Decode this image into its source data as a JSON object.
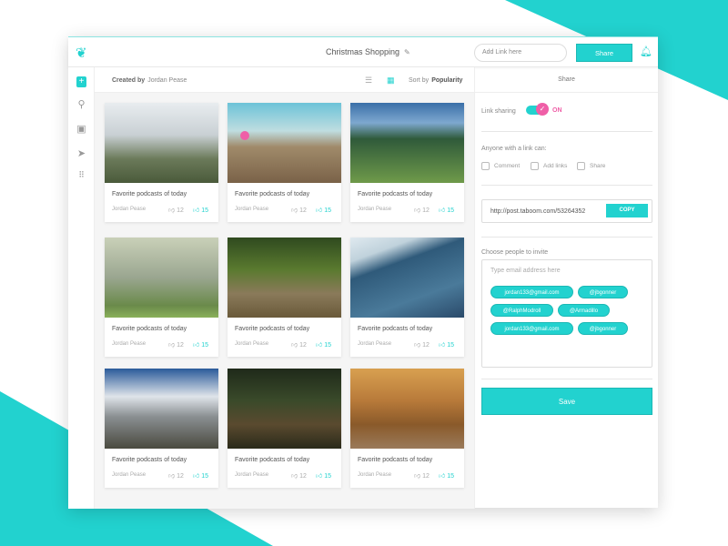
{
  "header": {
    "title": "Christmas Shopping",
    "add_link_placeholder": "Add Link here",
    "share_label": "Share"
  },
  "toolbar": {
    "created_by_label": "Created by",
    "creator": "Jordan Pease",
    "sort_label": "Sort by",
    "sort_value": "Popularity"
  },
  "cards": [
    {
      "title": "Favorite podcasts of today",
      "author": "Jordan Pease",
      "dislikes": "12",
      "likes": "15"
    },
    {
      "title": "Favorite podcasts of today",
      "author": "Jordan Pease",
      "dislikes": "12",
      "likes": "15"
    },
    {
      "title": "Favorite podcasts of today",
      "author": "Jordan Pease",
      "dislikes": "12",
      "likes": "15"
    },
    {
      "title": "Favorite podcasts of today",
      "author": "Jordan Pease",
      "dislikes": "12",
      "likes": "15"
    },
    {
      "title": "Favorite podcasts of today",
      "author": "Jordan Pease",
      "dislikes": "12",
      "likes": "15"
    },
    {
      "title": "Favorite podcasts of today",
      "author": "Jordan Pease",
      "dislikes": "12",
      "likes": "15"
    },
    {
      "title": "Favorite podcasts of today",
      "author": "Jordan Pease",
      "dislikes": "12",
      "likes": "15"
    },
    {
      "title": "Favorite podcasts of today",
      "author": "Jordan Pease",
      "dislikes": "12",
      "likes": "15"
    },
    {
      "title": "Favorite podcasts of today",
      "author": "Jordan Pease",
      "dislikes": "12",
      "likes": "15"
    }
  ],
  "panel": {
    "title": "Share",
    "link_sharing": "Link sharing",
    "toggle_state": "ON",
    "anyone_label": "Anyone with a link can:",
    "options": [
      "Comment",
      "Add links",
      "Share"
    ],
    "url": "http://post.taboom.com/53264352",
    "copy_label": "COPY",
    "invite_label": "Choose people to invite",
    "invite_placeholder": "Type email address here",
    "chips": [
      "jordan133@gmail.com",
      "@jbgonner",
      "@RalphModroll",
      "@Armadillo",
      "jordan133@gmail.com",
      "@jbgonner"
    ],
    "save_label": "Save"
  },
  "colors": {
    "accent": "#22d2cf",
    "pink": "#ef5fa7"
  }
}
